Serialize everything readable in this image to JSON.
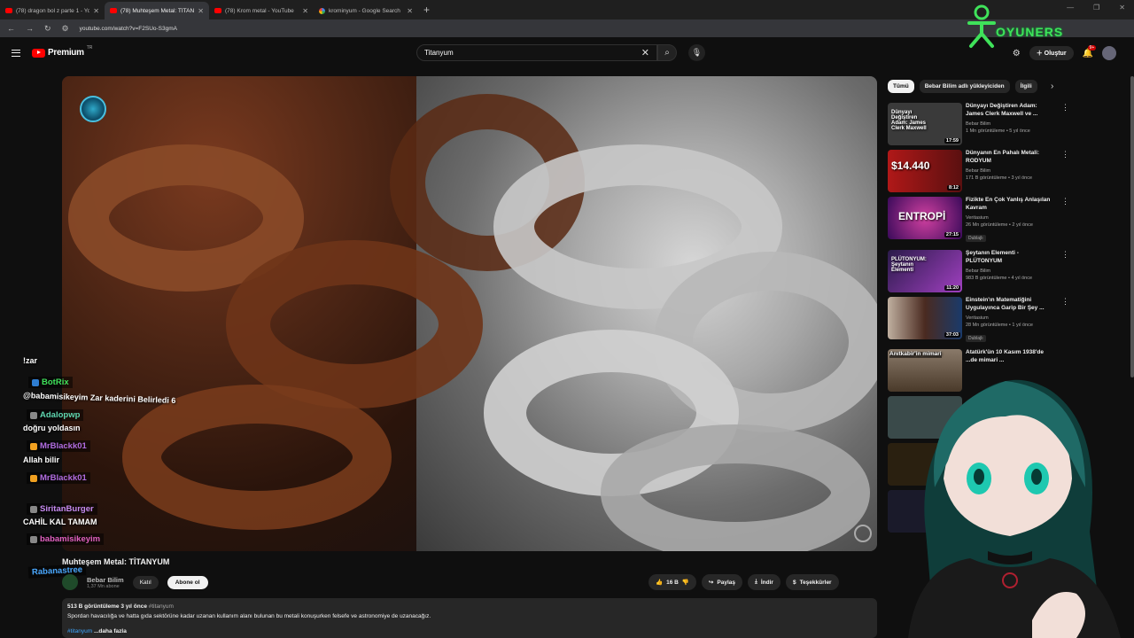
{
  "browser": {
    "tabs": [
      {
        "title": "(78) dragon bol z parte 1 - You",
        "icon": "youtube-icon"
      },
      {
        "title": "(78) Muhteşem Metal: TİTANYU",
        "icon": "youtube-icon",
        "active": true
      },
      {
        "title": "(78) Krom metal - YouTube",
        "icon": "youtube-icon"
      },
      {
        "title": "krominyum - Google Search",
        "icon": "google-icon"
      }
    ],
    "url": "youtube.com/watch?v=F2SUo-S3gmA"
  },
  "youtube": {
    "logo_text": "Premium",
    "logo_suffix": "TR",
    "search_value": "Titanyum",
    "create_label": "Oluştur",
    "notif_count": "9+"
  },
  "video": {
    "title": "Muhteşem Metal: TİTANYUM",
    "channel": "Bebar Bilim",
    "subscribers": "1,37 Mn abone",
    "join_label": "Katıl",
    "subscribe_label": "Abone ol",
    "likes": "16 B",
    "share_label": "Paylaş",
    "download_label": "İndir",
    "thanks_label": "Teşekkürler",
    "views_line": "513 B görüntüleme  3 yıl önce",
    "hashtag": "#titanyum",
    "description": "Spordan havacılığa ve hatta gıda sektörüne kadar uzanan kullanım alanı bulunan bu metali konuşurken felsefe ve astronomiye de uzanacağız.",
    "desc_tag": "#titanyum",
    "more_label": "...daha fazla"
  },
  "chips": [
    "Tümü",
    "Bebar Bilim adlı yükleyiciden",
    "İlgili"
  ],
  "recommendations": [
    {
      "title": "Dünyayı Değiştiren Adam: James Clerk Maxwell ve ...",
      "channel": "Bebar Bilim",
      "meta": "1 Mn görüntüleme • 5 yıl önce",
      "duration": "17:59",
      "overlay": "Dünyayı Değiştiren Adam: James Clerk Maxwell",
      "color": "#3a3a3a"
    },
    {
      "title": "Dünyanın En Pahalı Metali: RODYUM",
      "channel": "Bebar Bilim",
      "meta": "171 B görüntüleme • 3 yıl önce",
      "duration": "8:12",
      "overlay": "$14.440",
      "color": "#7a1c1c"
    },
    {
      "title": "Fizikte En Çok Yanlış Anlaşılan Kavram",
      "channel": "Veritasium",
      "meta": "26 Mn görüntüleme • 2 yıl önce",
      "duration": "27:15",
      "overlay": "ENTROPİ",
      "badge": "Dublajlı",
      "color": "#5a1a6a"
    },
    {
      "title": "Şeytanın Elementi - PLÜTONYUM",
      "channel": "Bebar Bilim",
      "meta": "983 B görüntüleme • 4 yıl önce",
      "duration": "11:20",
      "overlay": "PLÜTONYUM: Şeytanın Elementi",
      "color": "#5a2a7a"
    },
    {
      "title": "Einstein'ın Matematiğini Uygulayınca Garip Bir Şey ...",
      "channel": "Veritasium",
      "meta": "28 Mn görüntüleme • 1 yıl önce",
      "duration": "37:03",
      "badge": "Dublajlı",
      "color": "#6a4a3a"
    },
    {
      "title": "Atatürk'ün 10 Kasım 1938'de ...de mimari ...",
      "channel": "",
      "meta": "",
      "duration": "",
      "overlay": "Anıtkabir'in mimari",
      "color": "#6a5a4a"
    }
  ],
  "chat": [
    {
      "kind": "text",
      "text": "!zar"
    },
    {
      "kind": "user",
      "name": "BotRix",
      "color": "#3fe25a"
    },
    {
      "kind": "text",
      "text": "@babamisikeyim Zar kaderini Belirledi 6"
    },
    {
      "kind": "user",
      "name": "Adalopwp",
      "color": "#5fd7b0"
    },
    {
      "kind": "text",
      "text": "doğru yoldasın"
    },
    {
      "kind": "user",
      "name": "MrBlackk01",
      "color": "#b06ce0"
    },
    {
      "kind": "text",
      "text": "Allah bilir"
    },
    {
      "kind": "user",
      "name": "MrBlackk01",
      "color": "#b06ce0"
    },
    {
      "kind": "user",
      "name": "SiritanBurger",
      "color": "#c58af0"
    },
    {
      "kind": "text",
      "text": "CAHİL KAL TAMAM"
    },
    {
      "kind": "user",
      "name": "babamisikeyim",
      "color": "#e060c0"
    },
    {
      "kind": "user",
      "name": "Rabanastree",
      "color": "#4aa8ff"
    }
  ],
  "overlay_brand": "OYUNERS",
  "colors": {
    "accent": "#ff0000",
    "link": "#3ea6ff",
    "bg": "#0f0f0f"
  }
}
